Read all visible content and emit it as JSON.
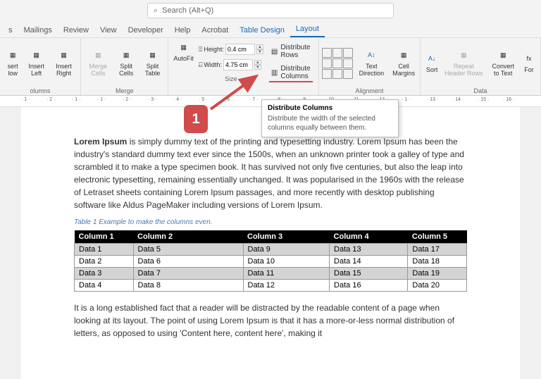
{
  "search": {
    "placeholder": "Search (Alt+Q)"
  },
  "tabs": {
    "items": [
      "s",
      "Mailings",
      "Review",
      "View",
      "Developer",
      "Help",
      "Acrobat",
      "Table Design",
      "Layout"
    ]
  },
  "ribbon": {
    "rows_cols": {
      "label": "olumns",
      "insert_below": "sert\nlow",
      "insert_left": "Insert\nLeft",
      "insert_right": "Insert\nRight"
    },
    "merge": {
      "label": "Merge",
      "merge": "Merge\nCells",
      "split": "Split\nCells",
      "split_table": "Split\nTable"
    },
    "cellsize": {
      "label": "Size",
      "autofit": "AutoFit",
      "height": "Height:",
      "width": "Width:",
      "h_val": "0.4 cm",
      "w_val": "4.75 cm",
      "dist_rows": "Distribute Rows",
      "dist_cols": "Distribute Columns"
    },
    "alignment": {
      "label": "Alignment",
      "text_dir": "Text\nDirection",
      "cell_marg": "Cell\nMargins"
    },
    "data": {
      "label": "Data",
      "sort": "Sort",
      "repeat": "Repeat\nHeader Rows",
      "convert": "Convert\nto Text",
      "formula": "For"
    }
  },
  "tooltip": {
    "title": "Distribute Columns",
    "desc": "Distribute the width of the selected columns equally between them."
  },
  "annotation": {
    "badge": "1"
  },
  "doc": {
    "p1_bold": "Lorem Ipsum",
    "p1_rest": " is simply dummy text of the printing and typesetting industry. Lorem Ipsum has been the industry's standard dummy text ever since the 1500s, when an unknown printer took a galley of type and scrambled it to make a type specimen book. It has survived not only five centuries, but also the leap into electronic typesetting, remaining essentially unchanged. It was popularised in the 1960s with the release of Letraset sheets containing Lorem Ipsum passages, and more recently with desktop publishing software like Aldus PageMaker including versions of Lorem Ipsum.",
    "caption": "Table 1 Example to make the columns even.",
    "headers": [
      "Column 1",
      "Column 2",
      "Column 3",
      "Column 4",
      "Column 5"
    ],
    "rows": [
      [
        "Data 1",
        "Data 5",
        "Data 9",
        "Data 13",
        "Data 17"
      ],
      [
        "Data 2",
        "Data 6",
        "Data 10",
        "Data 14",
        "Data 18"
      ],
      [
        "Data 3",
        "Data 7",
        "Data 11",
        "Data 15",
        "Data 19"
      ],
      [
        "Data 4",
        "Data 8",
        "Data 12",
        "Data 16",
        "Data 20"
      ]
    ],
    "p2": "It is a long established fact that a reader will be distracted by the readable content of a page when looking at its layout. The point of using Lorem Ipsum is that it has a more-or-less normal distribution of letters, as opposed to using 'Content here, content here', making it"
  },
  "ruler": {
    "marks": [
      "1",
      "2",
      "1",
      "1",
      "2",
      "3",
      "4",
      "5",
      "6",
      "7",
      "8",
      "9",
      "10",
      "11",
      "12",
      "1",
      "13",
      "14",
      "15",
      "16"
    ]
  }
}
